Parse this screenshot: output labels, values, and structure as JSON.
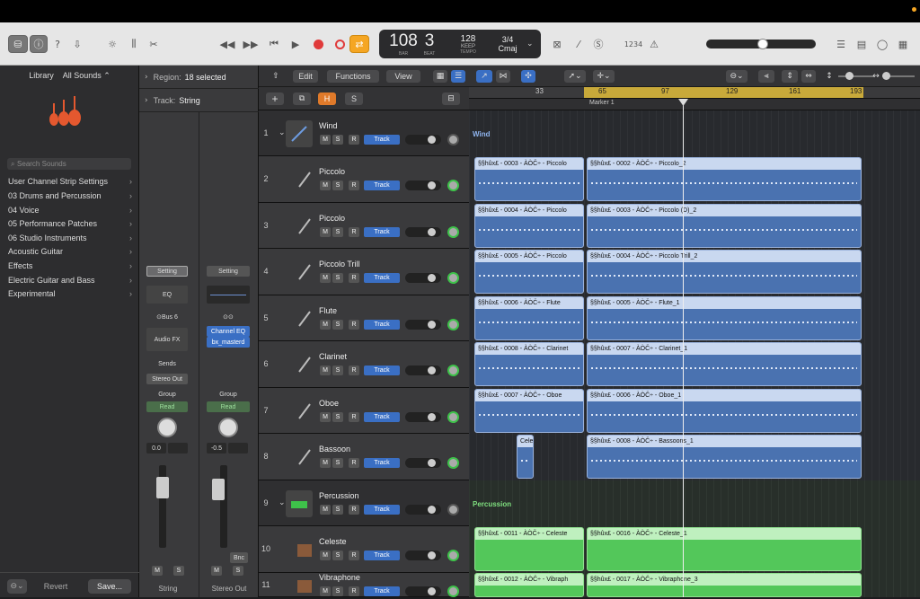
{
  "control_bar": {
    "tempo": "108",
    "tempo_label": "BAR",
    "bar": "3",
    "beat_label": "BEAT",
    "bpm": "128",
    "keep_label": "KEEP",
    "tempo_word": "TEMPO",
    "time_sig": "3/4",
    "key": "Cmaj",
    "count_in": "1234"
  },
  "library": {
    "title": "Library",
    "filter": "All Sounds ⌃",
    "search_placeholder": "Search Sounds",
    "items": [
      "User Channel Strip Settings",
      "03 Drums and Percussion",
      "04 Voice",
      "05 Performance Patches",
      "06 Studio Instruments",
      "Acoustic Guitar",
      "Effects",
      "Electric Guitar and Bass",
      "Experimental"
    ],
    "revert": "Revert",
    "save": "Save..."
  },
  "inspector": {
    "region_label": "Region:",
    "region_value": "18 selected",
    "track_label": "Track:",
    "track_value": "String",
    "left": {
      "setting": "Setting",
      "eq": "EQ",
      "bus": "Bus 6",
      "audio_fx": "Audio FX",
      "sends": "Sends",
      "output": "Stereo Out",
      "group": "Group",
      "read": "Read",
      "volume": "0.0",
      "name": "String"
    },
    "right": {
      "setting": "Setting",
      "fx1": "Channel EQ",
      "fx2": "bx_masterd",
      "group": "Group",
      "read": "Read",
      "volume": "-0.5",
      "bnc": "Bnc",
      "name": "Stereo Out"
    },
    "mute": "M",
    "solo": "S"
  },
  "arrange": {
    "edit": "Edit",
    "functions": "Functions",
    "view": "View",
    "h": "H",
    "s": "S",
    "marker": "Marker 1",
    "ruler": [
      "33",
      "65",
      "97",
      "129",
      "161",
      "193"
    ]
  },
  "tracks": [
    {
      "num": "1",
      "name": "Wind",
      "folder": true
    },
    {
      "num": "2",
      "name": "Piccolo"
    },
    {
      "num": "3",
      "name": "Piccolo"
    },
    {
      "num": "4",
      "name": "Piccolo Trill"
    },
    {
      "num": "5",
      "name": "Flute"
    },
    {
      "num": "6",
      "name": "Clarinet"
    },
    {
      "num": "7",
      "name": "Oboe"
    },
    {
      "num": "8",
      "name": "Bassoon"
    },
    {
      "num": "9",
      "name": "Percussion",
      "folder": true
    },
    {
      "num": "10",
      "name": "Celeste"
    },
    {
      "num": "11",
      "name": "Vibraphone"
    }
  ],
  "track_buttons": {
    "m": "M",
    "s": "S",
    "r": "R",
    "track": "Track"
  },
  "folders": {
    "wind": "Wind",
    "percussion": "Percussion"
  },
  "regions": {
    "r2a": "§§hûx£ - 0003 - ÀÒČ÷ - Piccolo",
    "r2b": "§§hûx£ - 0002 - ÀÒČ÷ - Piccolo_2",
    "r3a": "§§hûx£ - 0004 - ÀÒČ÷ - Piccolo",
    "r3b": "§§hûx£ - 0003 - ÀÒČ÷ - Piccolo (D)_2",
    "r4a": "§§hûx£ - 0005 - ÀÒČ÷ - Piccolo",
    "r4b": "§§hûx£ - 0004 - ÀÒČ÷ - Piccolo Trill_2",
    "r5a": "§§hûx£ - 0006 - ÀÒČ÷ - Flute",
    "r5b": "§§hûx£ - 0005 - ÀÒČ÷ - Flute_1",
    "r6a": "§§hûx£ - 0008 - ÀÒČ÷ - Clarinet",
    "r6b": "§§hûx£ - 0007 - ÀÒČ÷ - Clarinet_1",
    "r7a": "§§hûx£ - 0007 - ÀÒČ÷ - Oboe",
    "r7b": "§§hûx£ - 0006 - ÀÒČ÷ - Oboe_1",
    "r8a": "Cele",
    "r8b": "§§hûx£ - 0008 - ÀÒČ÷ - Bassoons_1",
    "r10a": "§§hûx£ - 0011 - ÀÒČ÷ - Celeste",
    "r10b": "§§hûx£ - 0016 - ÀÒČ÷ - Celeste_1",
    "r11a": "§§hûx£ - 0012 - ÀÒČ÷ - Vibraph",
    "r11b": "§§hûx£ - 0017 - ÀÒČ÷ - Vibraphone_3"
  },
  "colors": {
    "accent_yellow": "#f5a623",
    "record": "#e03a3a",
    "region_blue": "#4a72b0",
    "region_green": "#53c75a",
    "track_blue": "#3a6fc4"
  }
}
